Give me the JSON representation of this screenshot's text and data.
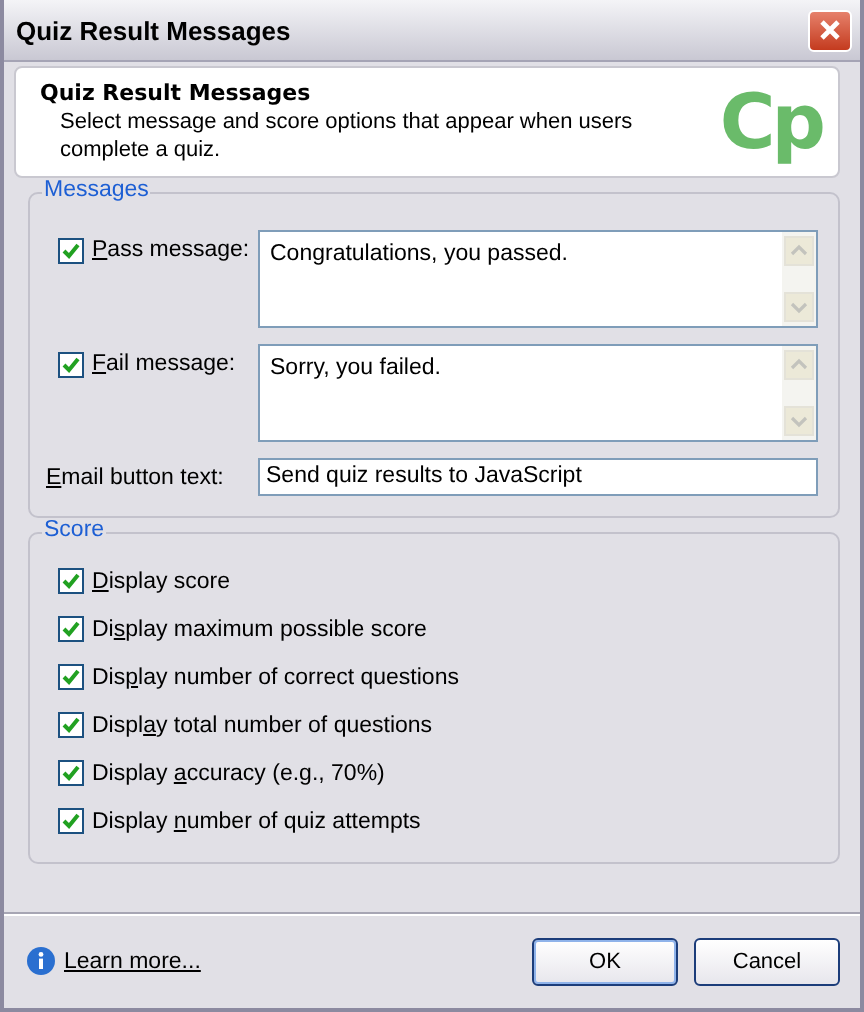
{
  "window": {
    "title": "Quiz Result Messages"
  },
  "header": {
    "title": "Quiz Result Messages",
    "description": "Select message and score options that appear when users complete a quiz.",
    "logo": "Cp"
  },
  "messages": {
    "legend": "Messages",
    "fields": [
      {
        "label": "Pass message:",
        "checked": true,
        "value": "Congratulations, you passed.",
        "kind": "textarea"
      },
      {
        "label": "Fail message:",
        "checked": true,
        "value": "Sorry, you failed.",
        "kind": "textarea"
      },
      {
        "label": "Email button text:",
        "value": "Send quiz results to JavaScript",
        "kind": "input"
      }
    ]
  },
  "score": {
    "legend": "Score",
    "options": [
      {
        "label": "Display score",
        "checked": true
      },
      {
        "label": "Display maximum possible score",
        "checked": true
      },
      {
        "label": "Display number of correct questions",
        "checked": true
      },
      {
        "label": "Display total number of questions",
        "checked": true
      },
      {
        "label": "Display accuracy (e.g., 70%)",
        "checked": true
      },
      {
        "label": "Display number of quiz attempts",
        "checked": true
      }
    ]
  },
  "footer": {
    "link": "Learn more...",
    "buttons": [
      {
        "label": "OK",
        "default": true
      },
      {
        "label": "Cancel",
        "default": false
      }
    ]
  }
}
